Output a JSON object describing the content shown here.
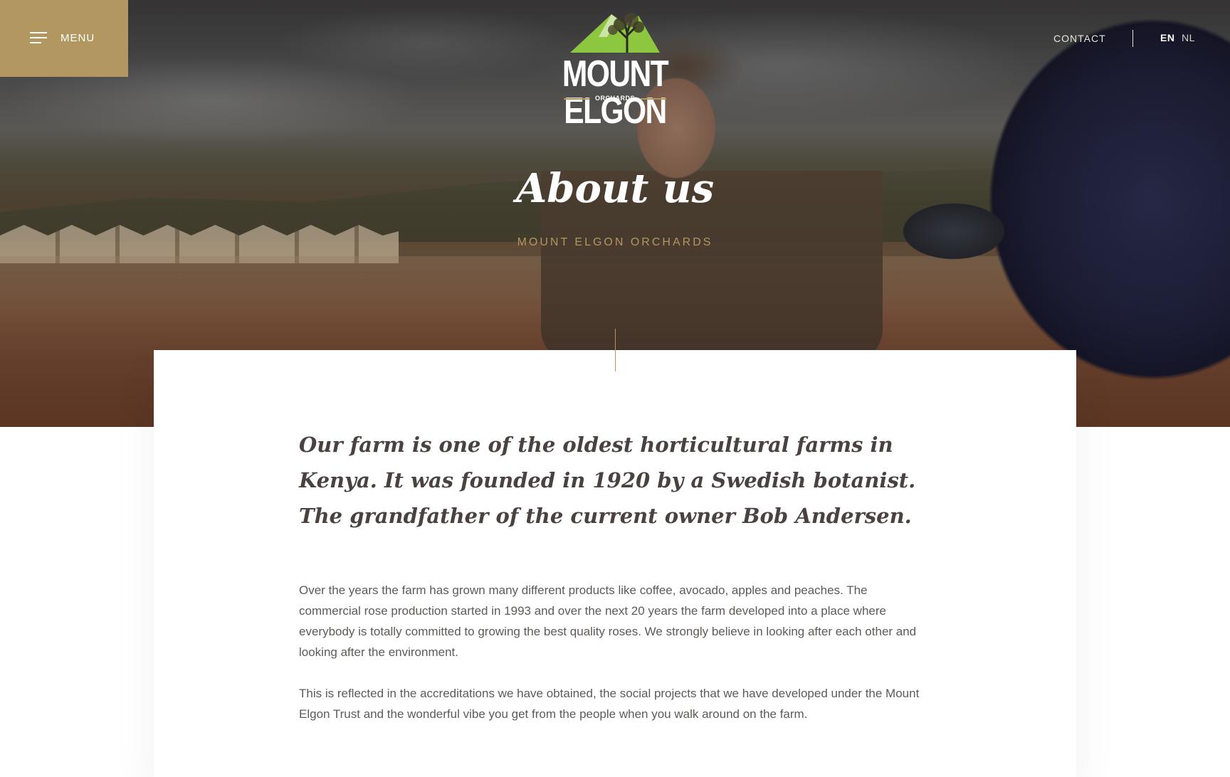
{
  "header": {
    "menu_label": "MENU",
    "logo": {
      "name": "MOUNT ELGON",
      "sub": "ORCHARDS"
    },
    "contact_label": "CONTACT",
    "languages": [
      {
        "code": "EN",
        "active": true
      },
      {
        "code": "NL",
        "active": false
      }
    ]
  },
  "hero": {
    "title": "About us",
    "subtitle": "MOUNT ELGON ORCHARDS"
  },
  "content": {
    "lead": "Our farm is one of the oldest horticultural farms in Kenya. It was founded in 1920 by a Swedish botanist. The grandfather of the current owner Bob Andersen.",
    "paragraphs": [
      "Over the years the farm has grown many different products like coffee, avocado, apples and peaches. The commercial rose production started in 1993 and over the next 20 years the farm developed into a place where everybody is totally committed to growing the best quality roses. We strongly believe in looking after each other and looking after the environment.",
      "This is reflected in the accreditations we have obtained, the social projects that we have developed under the Mount Elgon Trust and the wonderful vibe you get from the people when you walk around on the farm."
    ]
  },
  "colors": {
    "accent_gold": "#b39761",
    "logo_green": "#8dc63f",
    "text_dark": "#4a4240",
    "text_body": "#5e5a57"
  }
}
